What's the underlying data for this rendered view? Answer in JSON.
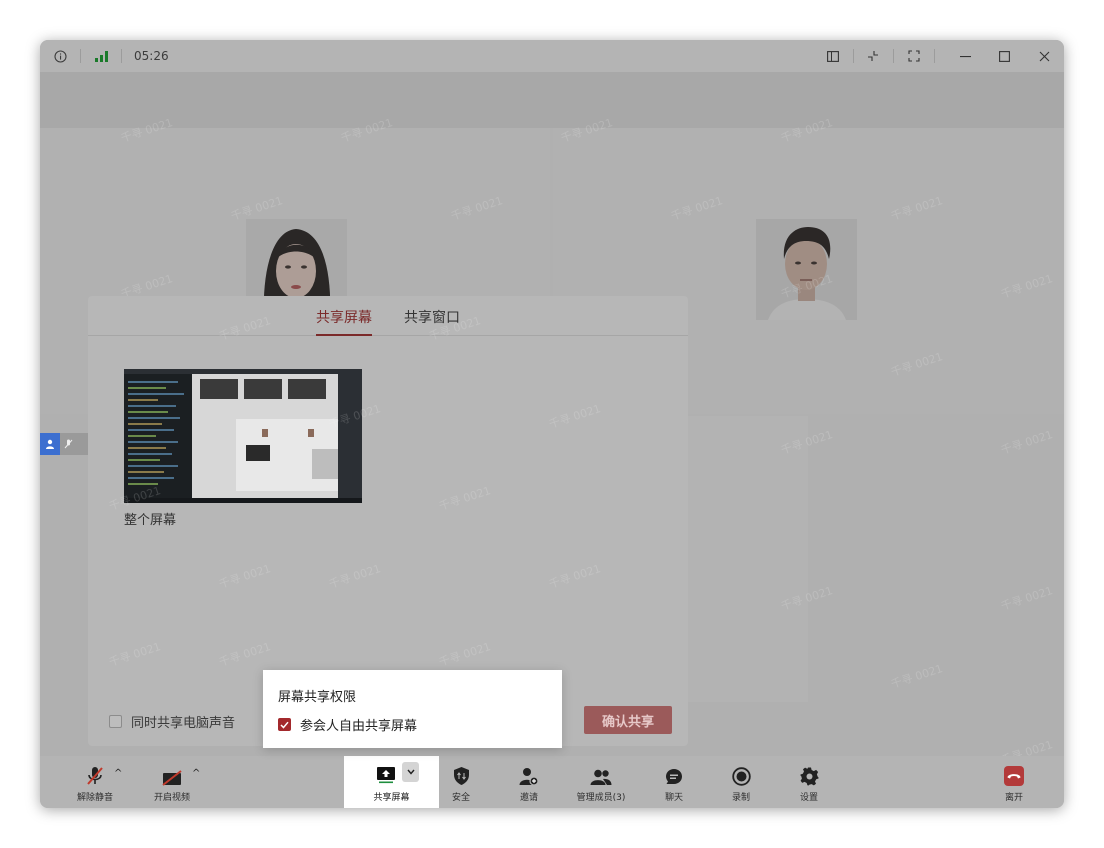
{
  "titlebar": {
    "clock": "05:26",
    "info_icon": "info-icon",
    "signal_icon": "signal-bars-icon",
    "buttons": [
      "sidebar-layout-icon",
      "collapse-icon",
      "fullscreen-icon",
      "minimize-icon",
      "maximize-icon",
      "close-icon"
    ]
  },
  "watermark": "千寻 0021",
  "dialog": {
    "tabs": [
      {
        "label": "共享屏幕",
        "active": true
      },
      {
        "label": "共享窗口",
        "active": false
      }
    ],
    "screen_caption": "整个屏幕",
    "share_audio_label": "同时共享电脑声音",
    "confirm_label": "确认共享"
  },
  "popup": {
    "title": "屏幕共享权限",
    "option_label": "参会人自由共享屏幕",
    "option_checked": true
  },
  "toolbar": {
    "unmute_label": "解除静音",
    "video_label": "开启视频",
    "share_label": "共享屏幕",
    "security_label": "安全",
    "invite_label": "邀请",
    "members_label": "管理成员(3)",
    "chat_label": "聊天",
    "record_label": "录制",
    "settings_label": "设置",
    "leave_label": "离开"
  },
  "colors": {
    "accent": "#7b2a2a",
    "checkbox_checked": "#a3292c",
    "leave": "#c0392b",
    "overlay_gray": "#b0b0b0"
  }
}
